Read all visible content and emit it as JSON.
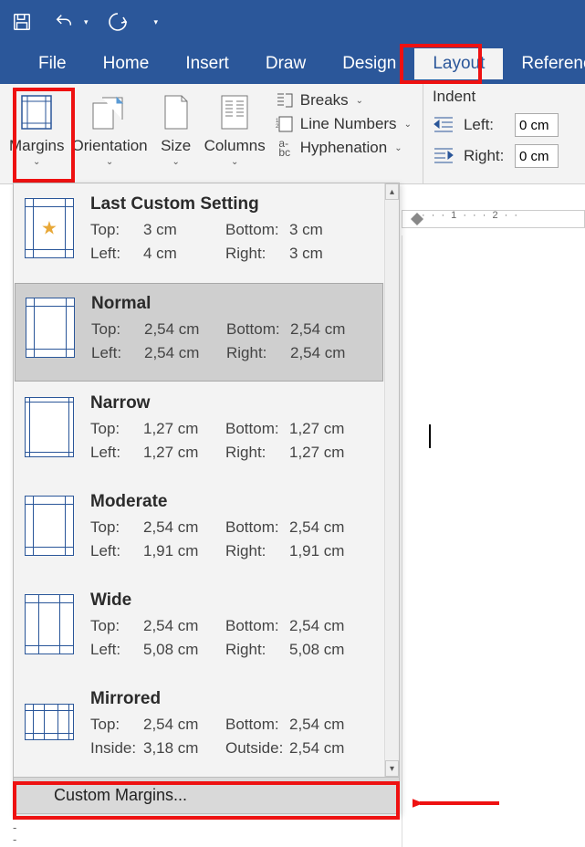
{
  "qat": {
    "save": "save-icon",
    "undo": "undo-icon",
    "redo": "redo-icon"
  },
  "tabs": {
    "file": "File",
    "home": "Home",
    "insert": "Insert",
    "draw": "Draw",
    "design": "Design",
    "layout": "Layout",
    "references": "References"
  },
  "ribbon": {
    "margins": "Margins",
    "orientation": "Orientation",
    "size": "Size",
    "columns": "Columns",
    "breaks": "Breaks",
    "line_numbers": "Line Numbers",
    "hyphenation": "Hyphenation"
  },
  "indent": {
    "title": "Indent",
    "left_label": "Left:",
    "right_label": "Right:",
    "left_value": "0 cm",
    "right_value": "0 cm"
  },
  "ruler": {
    "marks": "·  ·  ·  1  ·  ·  ·  2  ·  ·"
  },
  "menu": {
    "items": [
      {
        "title": "Last Custom Setting",
        "k1": "Top:",
        "v1": "3 cm",
        "k2": "Bottom:",
        "v2": "3 cm",
        "k3": "Left:",
        "v3": "4 cm",
        "k4": "Right:",
        "v4": "3 cm",
        "star": true
      },
      {
        "title": "Normal",
        "k1": "Top:",
        "v1": "2,54 cm",
        "k2": "Bottom:",
        "v2": "2,54 cm",
        "k3": "Left:",
        "v3": "2,54 cm",
        "k4": "Right:",
        "v4": "2,54 cm",
        "selected": true
      },
      {
        "title": "Narrow",
        "k1": "Top:",
        "v1": "1,27 cm",
        "k2": "Bottom:",
        "v2": "1,27 cm",
        "k3": "Left:",
        "v3": "1,27 cm",
        "k4": "Right:",
        "v4": "1,27 cm"
      },
      {
        "title": "Moderate",
        "k1": "Top:",
        "v1": "2,54 cm",
        "k2": "Bottom:",
        "v2": "2,54 cm",
        "k3": "Left:",
        "v3": "1,91 cm",
        "k4": "Right:",
        "v4": "1,91 cm"
      },
      {
        "title": "Wide",
        "k1": "Top:",
        "v1": "2,54 cm",
        "k2": "Bottom:",
        "v2": "2,54 cm",
        "k3": "Left:",
        "v3": "5,08 cm",
        "k4": "Right:",
        "v4": "5,08 cm"
      },
      {
        "title": "Mirrored",
        "k1": "Top:",
        "v1": "2,54 cm",
        "k2": "Bottom:",
        "v2": "2,54 cm",
        "k3": "Inside:",
        "v3": "3,18 cm",
        "k4": "Outside:",
        "v4": "2,54 cm",
        "mirrored": true
      }
    ],
    "footer": "Custom Margins..."
  },
  "colors": {
    "accent": "#2b579a",
    "highlight": "#e11"
  }
}
